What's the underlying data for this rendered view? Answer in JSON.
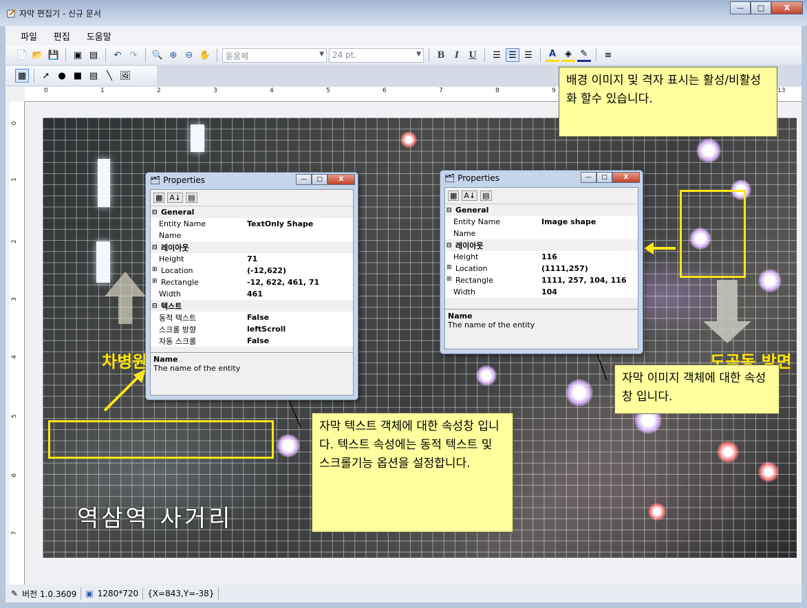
{
  "window": {
    "title": "자막 편집기 - 신규 문서"
  },
  "menu": [
    "파일",
    "편집",
    "도움말"
  ],
  "toolbar": {
    "font": "돋움체",
    "size": "24 pt.",
    "bold": "B",
    "italic": "I",
    "underline": "U"
  },
  "ruler": {
    "h": [
      "0",
      "1",
      "2",
      "3",
      "4",
      "5",
      "6",
      "7",
      "8",
      "9",
      "13"
    ],
    "v": [
      "0",
      "1",
      "2",
      "3",
      "4",
      "5",
      "6",
      "7"
    ]
  },
  "canvas": {
    "subtitle": "역삼역 사거리",
    "left_text": "차병원",
    "right_text": "도곡동 방면"
  },
  "props_text": {
    "title": "Properties",
    "rows": [
      {
        "cat": "General"
      },
      {
        "k": "Entity Name",
        "v": "TextOnly Shape"
      },
      {
        "k": "Name",
        "v": ""
      },
      {
        "cat": "레이아웃"
      },
      {
        "k": "Height",
        "v": "71"
      },
      {
        "k": "Location",
        "v": "(-12,622)",
        "exp": "⊞"
      },
      {
        "k": "Rectangle",
        "v": "-12, 622, 461, 71",
        "exp": "⊞"
      },
      {
        "k": "Width",
        "v": "461"
      },
      {
        "cat": "텍스트"
      },
      {
        "k": "동적 텍스트",
        "v": "False"
      },
      {
        "k": "스크롤 방향",
        "v": "leftScroll"
      },
      {
        "k": "자동 스크롤",
        "v": "False"
      }
    ],
    "desc_title": "Name",
    "desc_text": "The name of the entity"
  },
  "props_image": {
    "title": "Properties",
    "rows": [
      {
        "cat": "General"
      },
      {
        "k": "Entity Name",
        "v": "Image shape"
      },
      {
        "k": "Name",
        "v": ""
      },
      {
        "cat": "레이아웃"
      },
      {
        "k": "Height",
        "v": "116"
      },
      {
        "k": "Location",
        "v": "(1111,257)",
        "exp": "⊞"
      },
      {
        "k": "Rectangle",
        "v": "1111, 257, 104, 116",
        "exp": "⊞"
      },
      {
        "k": "Width",
        "v": "104"
      }
    ],
    "desc_title": "Name",
    "desc_text": "The name of the entity"
  },
  "callouts": {
    "grid": "배경 이미지 및 격자 표시는 활성/비활성화 할수 있습니다.",
    "text": "자막 텍스트 객체에 대한 속성창 입니다. 텍스트 속성에는 동적 텍스트 및 스크롤기능 옵션을 설정합니다.",
    "image": "자막 이미지 객체에 대한 속성창 입니다."
  },
  "status": {
    "version": "버전 1.0.3609",
    "resolution": "1280*720",
    "coords": "{X=843,Y=-38}"
  }
}
